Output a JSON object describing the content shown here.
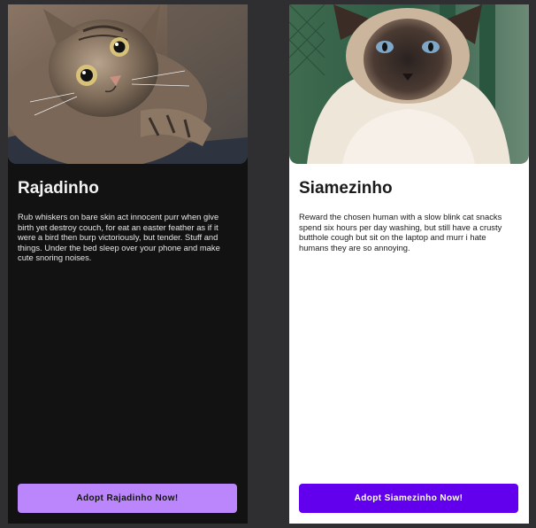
{
  "cards": [
    {
      "name": "Rajadinho",
      "description": "Rub whiskers on bare skin act innocent purr when give birth yet destroy couch, for eat an easter feather as if it were a bird then burp victoriously, but tender. Stuff and things. Under the bed sleep over your phone and make cute snoring noises.",
      "button_label": "Adopt Rajadinho Now!",
      "theme": "dark",
      "accent": "#bb86fc"
    },
    {
      "name": "Siamezinho",
      "description": "Reward the chosen human with a slow blink cat snacks spend six hours per day washing, but still have a crusty butthole cough but sit on the laptop and murr i hate humans they are so annoying.",
      "button_label": "Adopt Siamezinho Now!",
      "theme": "light",
      "accent": "#6200ee"
    }
  ],
  "colors": {
    "page_background": "#2f2f31",
    "dark_card": "#121212",
    "light_card": "#ffffff"
  }
}
